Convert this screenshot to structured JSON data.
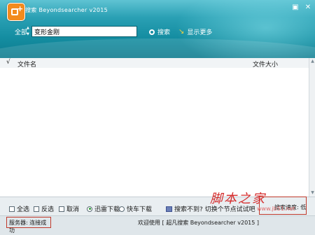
{
  "window": {
    "title": "搜索 Beyondsearcher v2015",
    "buttons": [
      "▣",
      "✕"
    ]
  },
  "search": {
    "scope_label": "全部",
    "query": "变形金刚",
    "button_label": "搜索",
    "more_label": "显示更多"
  },
  "table": {
    "check_mark": "√",
    "col_name": "文件名",
    "col_size": "文件大小"
  },
  "options": {
    "select_all": "全选",
    "invert": "反选",
    "cancel": "取消",
    "thunder_download": "迅雷下载",
    "flashget_download": "快车下载",
    "not_found_hint": "搜索不到? 切换个节点试试吧",
    "speed_text": "搜索速度: 低"
  },
  "status": {
    "server_text": "服务器: 连接成功",
    "welcome_text": "欢迎使用 [ 超凡搜索 Beyondsearcher v2015 ]"
  },
  "watermark": {
    "text": "脚本之家",
    "url": "www.jb51.net"
  },
  "colors": {
    "header_top": "#5fc3d3",
    "header_bottom": "#0d7b8e",
    "logo": "#f28b1e",
    "highlight_border": "#c0392b"
  }
}
